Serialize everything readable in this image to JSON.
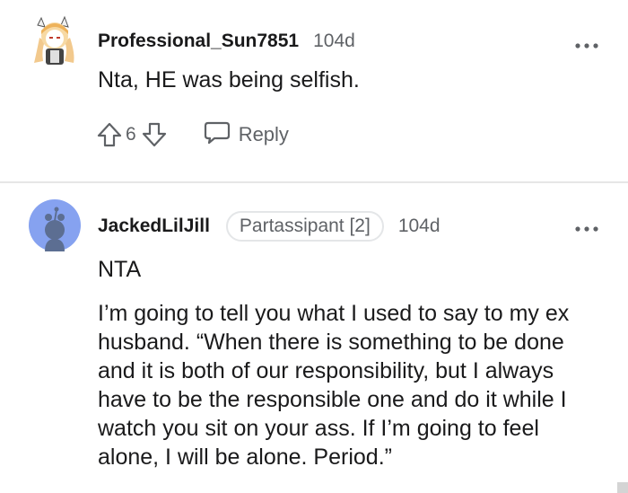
{
  "comments": [
    {
      "username": "Professional_Sun7851",
      "time": "104d",
      "body": "Nta, HE was being selfish.",
      "score": "6",
      "reply_label": "Reply",
      "avatar_icon": "anime-bunny-avatar-icon"
    },
    {
      "username": "JackedLilJill",
      "flair": "Partassipant [2]",
      "time": "104d",
      "body_line1": "NTA",
      "body_para2": "I’m going to tell you what I used to say to my ex husband. “When there is something to be done and it is both of our responsibility, but I always have to be the responsible one and do it while I watch you sit on your ass. If I’m going to feel alone, I will be alone. Period.”",
      "avatar_icon": "default-snoo-avatar-icon"
    }
  ],
  "colors": {
    "text": "#1a1a1b",
    "muted": "#5f6266",
    "divider": "#e6e6e6",
    "snoo_bg": "#86a2f0"
  }
}
